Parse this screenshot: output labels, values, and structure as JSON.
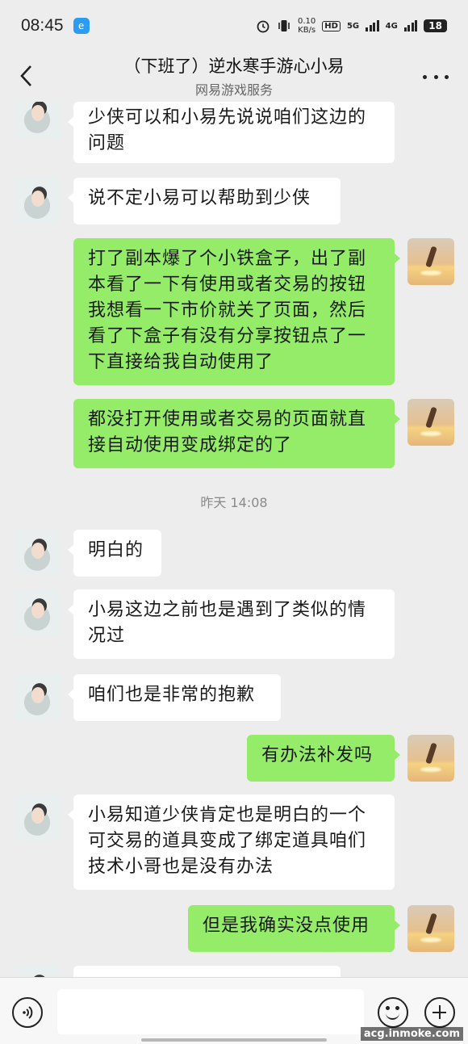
{
  "status_bar": {
    "time": "08:45",
    "app_icon": "e",
    "net_speed_value": "0.10",
    "net_speed_unit": "KB/s",
    "hd_label": "HD",
    "sim1_label": "5G",
    "sim2_label": "4G",
    "battery": "18"
  },
  "header": {
    "title": "（下班了）逆水寒手游心小易",
    "subtitle": "网易游戏服务"
  },
  "messages": [
    {
      "side": "left",
      "text": "少侠可以和小易先说说咱们这边的\n问题"
    },
    {
      "side": "left",
      "text": "说不定小易可以帮助到少侠"
    },
    {
      "side": "right",
      "text": "打了副本爆了个小铁盒子，出了副\n本看了一下有使用或者交易的按钮\n我想看一下市价就关了页面，然后\n看了下盒子有没有分享按钮点了一\n下直接给我自动使用了"
    },
    {
      "side": "right",
      "text": "都没打开使用或者交易的页面就直\n接自动使用变成绑定的了"
    },
    {
      "timestamp": "昨天 14:08"
    },
    {
      "side": "left",
      "text": "明白的"
    },
    {
      "side": "left",
      "text": "小易这边之前也是遇到了类似的情\n况过"
    },
    {
      "side": "left",
      "text": "咱们也是非常的抱歉"
    },
    {
      "side": "right",
      "text": "有办法补发吗"
    },
    {
      "side": "left",
      "text": "小易知道少侠肯定也是明白的一个\n可交易的道具变成了绑定道具咱们\n技术小哥也是没有办法"
    },
    {
      "side": "right",
      "text": "但是我确实没点使用"
    }
  ],
  "input_bar": {
    "value": "",
    "icons": [
      "voice-icon",
      "emoji-icon",
      "plus-icon"
    ]
  },
  "watermark": "acg.inmoke.com",
  "colors": {
    "background": "#ededed",
    "bubble_right": "#95ec69",
    "bubble_left": "#ffffff"
  }
}
